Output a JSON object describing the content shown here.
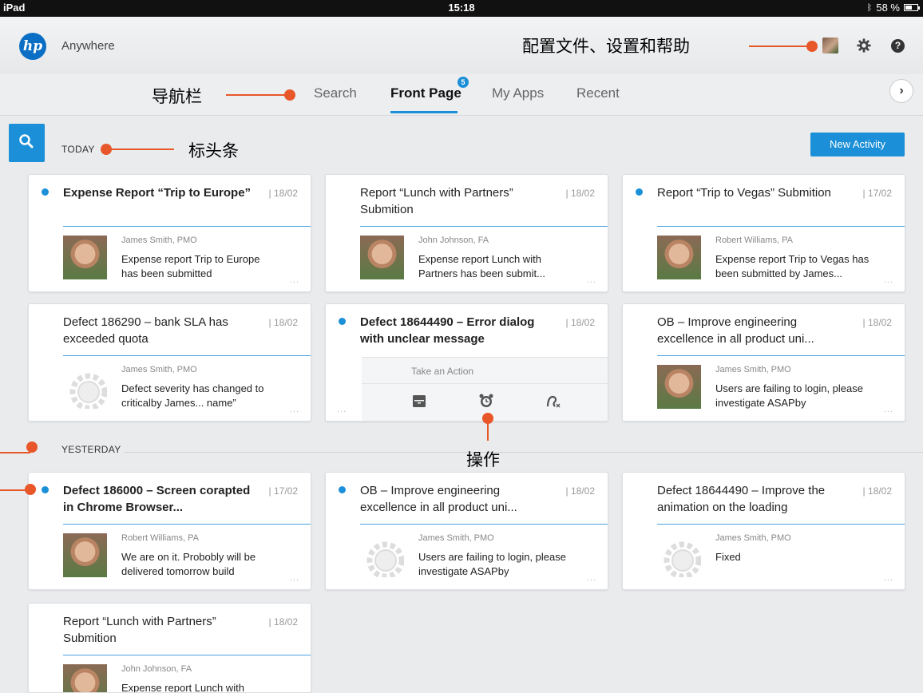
{
  "statusbar": {
    "device": "iPad",
    "time": "15:18",
    "battery": "58 %",
    "battery_level": 0.58
  },
  "header": {
    "app_name": "Anywhere",
    "logo_text": "hp",
    "help_glyph": "?"
  },
  "nav": {
    "tabs": [
      {
        "label": "Search",
        "active": false
      },
      {
        "label": "Front Page",
        "active": true,
        "badge": "5"
      },
      {
        "label": "My Apps",
        "active": false
      },
      {
        "label": "Recent",
        "active": false
      }
    ],
    "next_glyph": "›"
  },
  "sections": {
    "today": "TODAY",
    "yesterday": "YESTERDAY"
  },
  "new_activity_label": "New Activity",
  "more_glyph": "...",
  "cards": [
    {
      "title": "Expense Report “Trip to Europe”",
      "date": "| 18/02",
      "unread": true,
      "author": "James Smith, PMO",
      "message": "Expense report Trip to Europe has been submitted",
      "thumb": "face"
    },
    {
      "title": "Report “Lunch with Partners” Submition",
      "date": "| 18/02",
      "unread": false,
      "author": "John Johnson, FA",
      "message": "Expense report Lunch with Partners has been submit...",
      "thumb": "face"
    },
    {
      "title": "Report “Trip to Vegas” Submition",
      "date": "| 17/02",
      "unread": true,
      "author": "Robert Williams, PA",
      "message": "Expense report Trip to Vegas has been submitted by James...",
      "thumb": "face"
    },
    {
      "title": "Defect 186290 – bank SLA has exceeded quota",
      "date": "| 18/02",
      "unread": false,
      "author": "James Smith, PMO",
      "message": "Defect severity has changed to criticalby James... name”",
      "thumb": "gear"
    },
    {
      "title": "Defect 18644490 – Error dialog with unclear message",
      "date": "| 18/02",
      "unread": true,
      "action_label": "Take an Action",
      "actions": [
        "archive-icon",
        "alarm-icon",
        "unassign-icon"
      ]
    },
    {
      "title": "OB – Improve engineering excellence in all product uni...",
      "date": "| 18/02",
      "unread": false,
      "author": "James Smith, PMO",
      "message": "Users are failing to login, please investigate ASAPby",
      "thumb": "face"
    },
    {
      "title": "Defect 186000 – Screen corapted in Chrome Browser...",
      "date": "| 17/02",
      "unread": true,
      "author": "Robert Williams, PA",
      "message": "We are on it. Probobly will be delivered tomorrow build",
      "thumb": "face"
    },
    {
      "title": "OB – Improve engineering excellence in all product uni...",
      "date": "| 18/02",
      "unread": true,
      "author": "James Smith, PMO",
      "message": "Users are failing to login, please investigate ASAPby",
      "thumb": "gear"
    },
    {
      "title": "Defect 18644490 – Improve the animation on the loading",
      "date": "| 18/02",
      "unread": false,
      "author": "James Smith, PMO",
      "message": "Fixed",
      "thumb": "gear"
    },
    {
      "title": "Report “Lunch with Partners” Submition",
      "date": "| 18/02",
      "unread": false,
      "author": "John Johnson, FA",
      "message": "Expense report Lunch with",
      "thumb": "face"
    }
  ],
  "annotations": {
    "profile": "配置文件、设置和帮助",
    "navbar": "导航栏",
    "header_bar": "标头条",
    "actions": "操作"
  },
  "colors": {
    "accent": "#1b8fd8",
    "annotation": "#e8572a"
  }
}
